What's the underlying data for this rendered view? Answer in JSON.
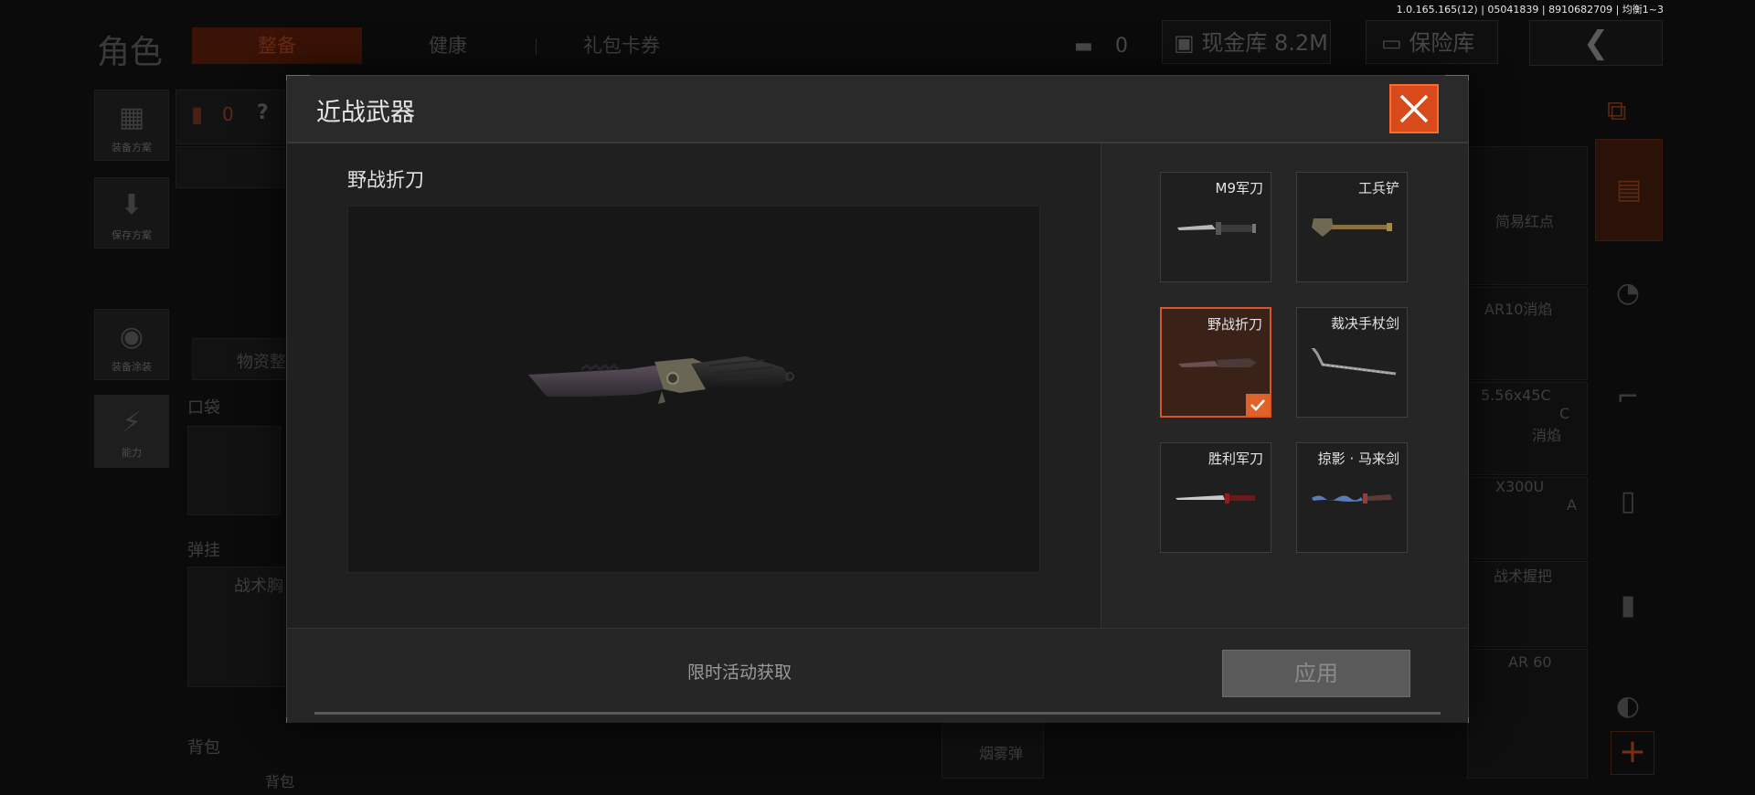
{
  "version": "1.0.165.165(12) | 05041839 | 8910682709 | 均衡1~3",
  "background": {
    "title": "角色",
    "tabs": [
      "整备",
      "健康",
      "礼包卡券"
    ],
    "currency_count": "0",
    "cash_label": "现金库 8.2M",
    "safe_label": "保险库",
    "left_nav": [
      "装备方案",
      "保存方案",
      "装备涂装",
      "能力"
    ],
    "armor_count": "0",
    "help_symbol": "?",
    "supplies_label": "物资整",
    "pocket_label": "口袋",
    "ammo_label": "弹挂",
    "vest_label": "战术胸",
    "backpack_label": "背包",
    "backpack_sub": "背包",
    "smoke_label": "烟雾弹",
    "attachments": [
      "简易红点",
      "AR10消焰",
      "5.56x45C",
      "C",
      "消焰",
      "X300U",
      "A",
      "战术握把",
      "AR 60"
    ]
  },
  "modal": {
    "title": "近战武器",
    "selected_item_name": "野战折刀",
    "obtain_text": "限时活动获取",
    "apply_label": "应用",
    "weapons": [
      {
        "name": "M9军刀",
        "icon": "bayonet-icon"
      },
      {
        "name": "工兵铲",
        "icon": "shovel-icon"
      },
      {
        "name": "野战折刀",
        "icon": "folding-knife-icon",
        "selected": true
      },
      {
        "name": "裁决手杖剑",
        "icon": "cane-sword-icon"
      },
      {
        "name": "胜利军刀",
        "icon": "saber-icon"
      },
      {
        "name": "掠影 · 马来剑",
        "icon": "kris-icon"
      }
    ]
  },
  "colors": {
    "accent": "#d8552a",
    "close_bg": "#d84a1c",
    "modal_bg": "#222222"
  }
}
